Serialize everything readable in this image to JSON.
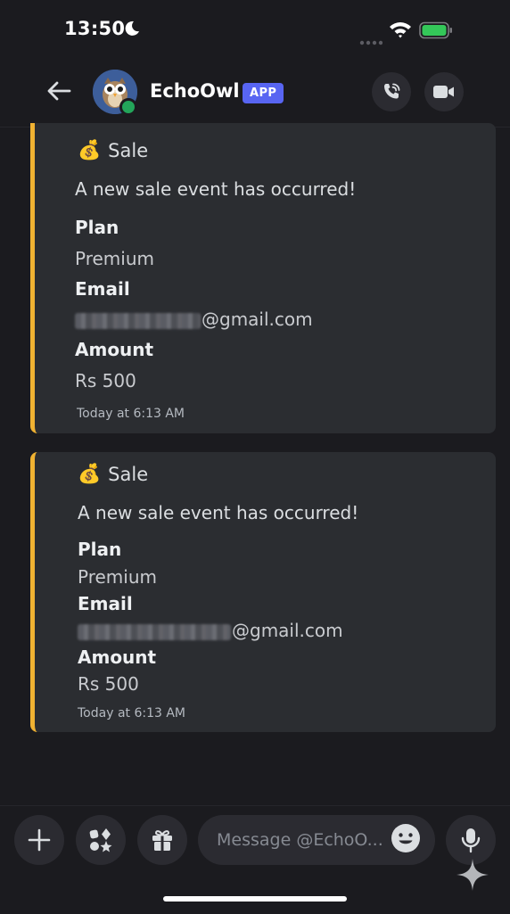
{
  "status": {
    "time": "13:50"
  },
  "header": {
    "title": "EchoOwl",
    "badge": "APP"
  },
  "messages": [
    {
      "emoji": "💰",
      "title": "Sale",
      "description": "A new sale event has occurred!",
      "fields": [
        {
          "name": "Plan",
          "value": "Premium"
        },
        {
          "name": "Email",
          "value": "@gmail.com"
        },
        {
          "name": "Amount",
          "value": "Rs 500"
        }
      ],
      "timestamp": "Today at 6:13 AM"
    },
    {
      "emoji": "💰",
      "title": "Sale",
      "description": "A new sale event has occurred!",
      "fields": [
        {
          "name": "Plan",
          "value": "Premium"
        },
        {
          "name": "Email",
          "value": "@gmail.com"
        },
        {
          "name": "Amount",
          "value": "Rs 500"
        }
      ],
      "timestamp": "Today at 6:13 AM"
    }
  ],
  "composer": {
    "placeholder": "Message @EchoO..."
  },
  "colors": {
    "embed_accent": "#f0b232",
    "app_badge": "#5865f2",
    "online": "#23a55a",
    "battery": "#34c759"
  },
  "icons": [
    "moon-icon",
    "wifi-icon",
    "battery-icon",
    "back-arrow-icon",
    "phone-icon",
    "video-icon",
    "plus-icon",
    "apps-icon",
    "gift-icon",
    "emoji-icon",
    "microphone-icon",
    "sparkle-icon"
  ]
}
